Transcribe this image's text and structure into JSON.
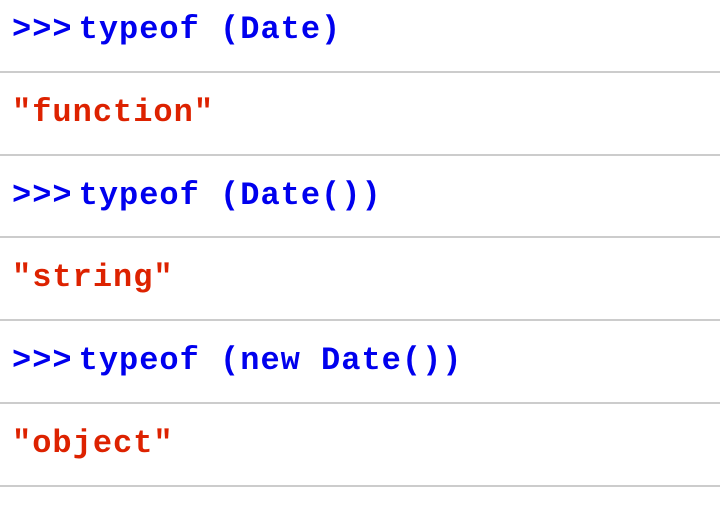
{
  "console": {
    "prompt": ">>>",
    "lines": [
      {
        "type": "input",
        "text": "typeof (Date)"
      },
      {
        "type": "output",
        "text": "\"function\""
      },
      {
        "type": "input",
        "text": "typeof (Date())"
      },
      {
        "type": "output",
        "text": "\"string\""
      },
      {
        "type": "input",
        "text": "typeof (new Date())"
      },
      {
        "type": "output",
        "text": "\"object\""
      }
    ]
  }
}
